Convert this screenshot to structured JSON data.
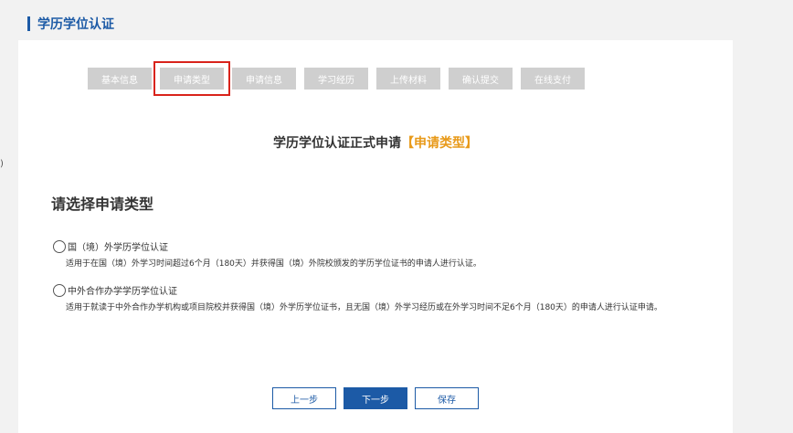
{
  "header": {
    "title": "学历学位认证"
  },
  "left_mark": ")",
  "steps": [
    {
      "label": "基本信息"
    },
    {
      "label": "申请类型"
    },
    {
      "label": "申请信息"
    },
    {
      "label": "学习经历"
    },
    {
      "label": "上传材料"
    },
    {
      "label": "确认提交"
    },
    {
      "label": "在线支付"
    }
  ],
  "active_step": "申请类型",
  "form": {
    "title": "学历学位认证正式申请",
    "title_accent": "【申请类型】",
    "section_title": "请选择申请类型"
  },
  "options": [
    {
      "label": "国（境）外学历学位认证",
      "desc": "适用于在国（境）外学习时间超过6个月（180天）并获得国（境）外院校颁发的学历学位证书的申请人进行认证。"
    },
    {
      "label": "中外合作办学学历学位认证",
      "desc": "适用于就读于中外合作办学机构或项目院校并获得国（境）外学历学位证书，且无国（境）外学习经历或在外学习时间不足6个月（180天）的申请人进行认证申请。"
    }
  ],
  "buttons": {
    "prev": "上一步",
    "next": "下一步",
    "save": "保存"
  },
  "colors": {
    "brand": "#1c5aa6",
    "accent": "#e89a1a",
    "highlight": "#d9231b",
    "step_bg": "#cfcfcf"
  }
}
